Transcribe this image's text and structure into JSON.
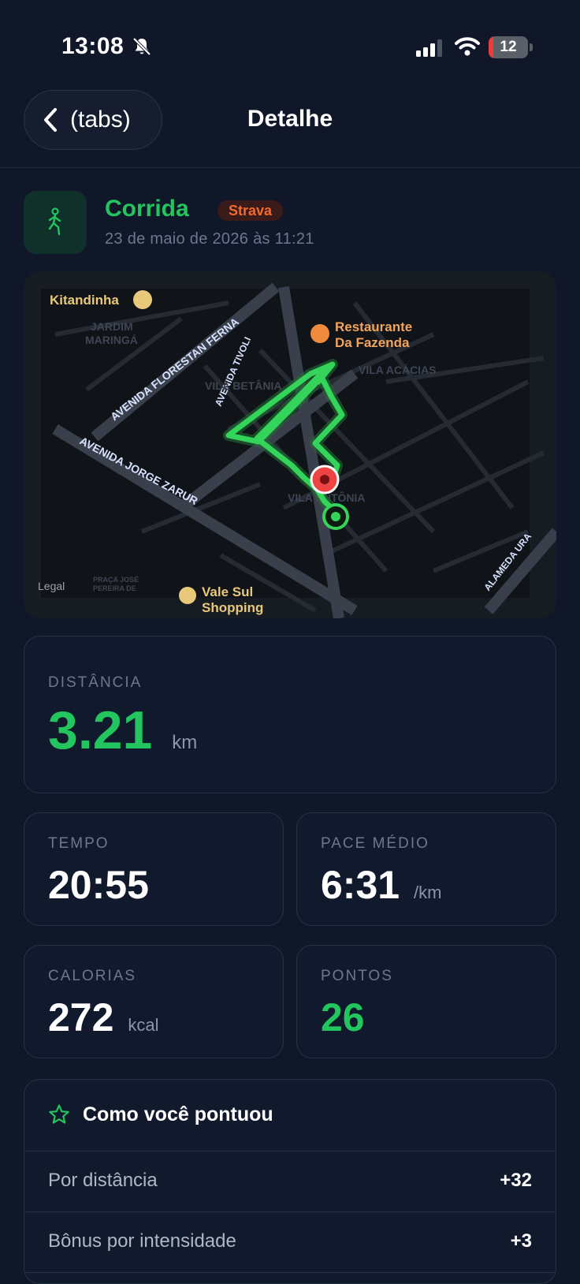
{
  "status_bar": {
    "time": "13:08",
    "battery": "12",
    "battery_level": 0.12
  },
  "nav": {
    "back_label": "(tabs)",
    "title": "Detalhe"
  },
  "activity": {
    "type": "Corrida",
    "source": "Strava",
    "date": "23 de maio de 2026 às 11:21"
  },
  "map": {
    "labels": {
      "kitandinha": "Kitandinha",
      "jardim": "JARDIM",
      "maringa": "MARINGÁ",
      "avenida_florestan": "AVENIDA FLORESTAN FERNA",
      "avenida_tivoli": "AVENIDA TIVOLI",
      "restaurante_1": "Restaurante",
      "restaurante_2": "Da Fazenda",
      "vila_acacias": "VILA ACÁCIAS",
      "vila_betania": "VILA BETÂNIA",
      "avenida_jorge": "AVENIDA JORGE ZARUR",
      "vila_antonia": "VILA ANTÔNIA",
      "alameda": "ALAMEDA URA",
      "legal": "Legal",
      "praca_1": "PRAÇA JOSÉ",
      "praca_2": "PEREIRA DE",
      "vale_sul_1": "Vale Sul",
      "vale_sul_2": "Shopping"
    }
  },
  "stats": {
    "distance": {
      "label": "DISTÂNCIA",
      "value": "3.21",
      "unit": "km"
    },
    "time": {
      "label": "TEMPO",
      "value": "20:55"
    },
    "pace": {
      "label": "PACE MÉDIO",
      "value": "6:31",
      "unit": "/km"
    },
    "calories": {
      "label": "CALORIAS",
      "value": "272",
      "unit": "kcal"
    },
    "points": {
      "label": "PONTOS",
      "value": "26"
    }
  },
  "scoring": {
    "title": "Como você pontuou",
    "rows": [
      {
        "label": "Por distância",
        "value": "+32"
      },
      {
        "label": "Bônus por intensidade",
        "value": "+3"
      }
    ]
  },
  "colors": {
    "accent": "#22c55e",
    "background": "#0f1729",
    "card": "#111a2c",
    "strava": "#f26a2c",
    "end_marker": "#ef4444"
  }
}
